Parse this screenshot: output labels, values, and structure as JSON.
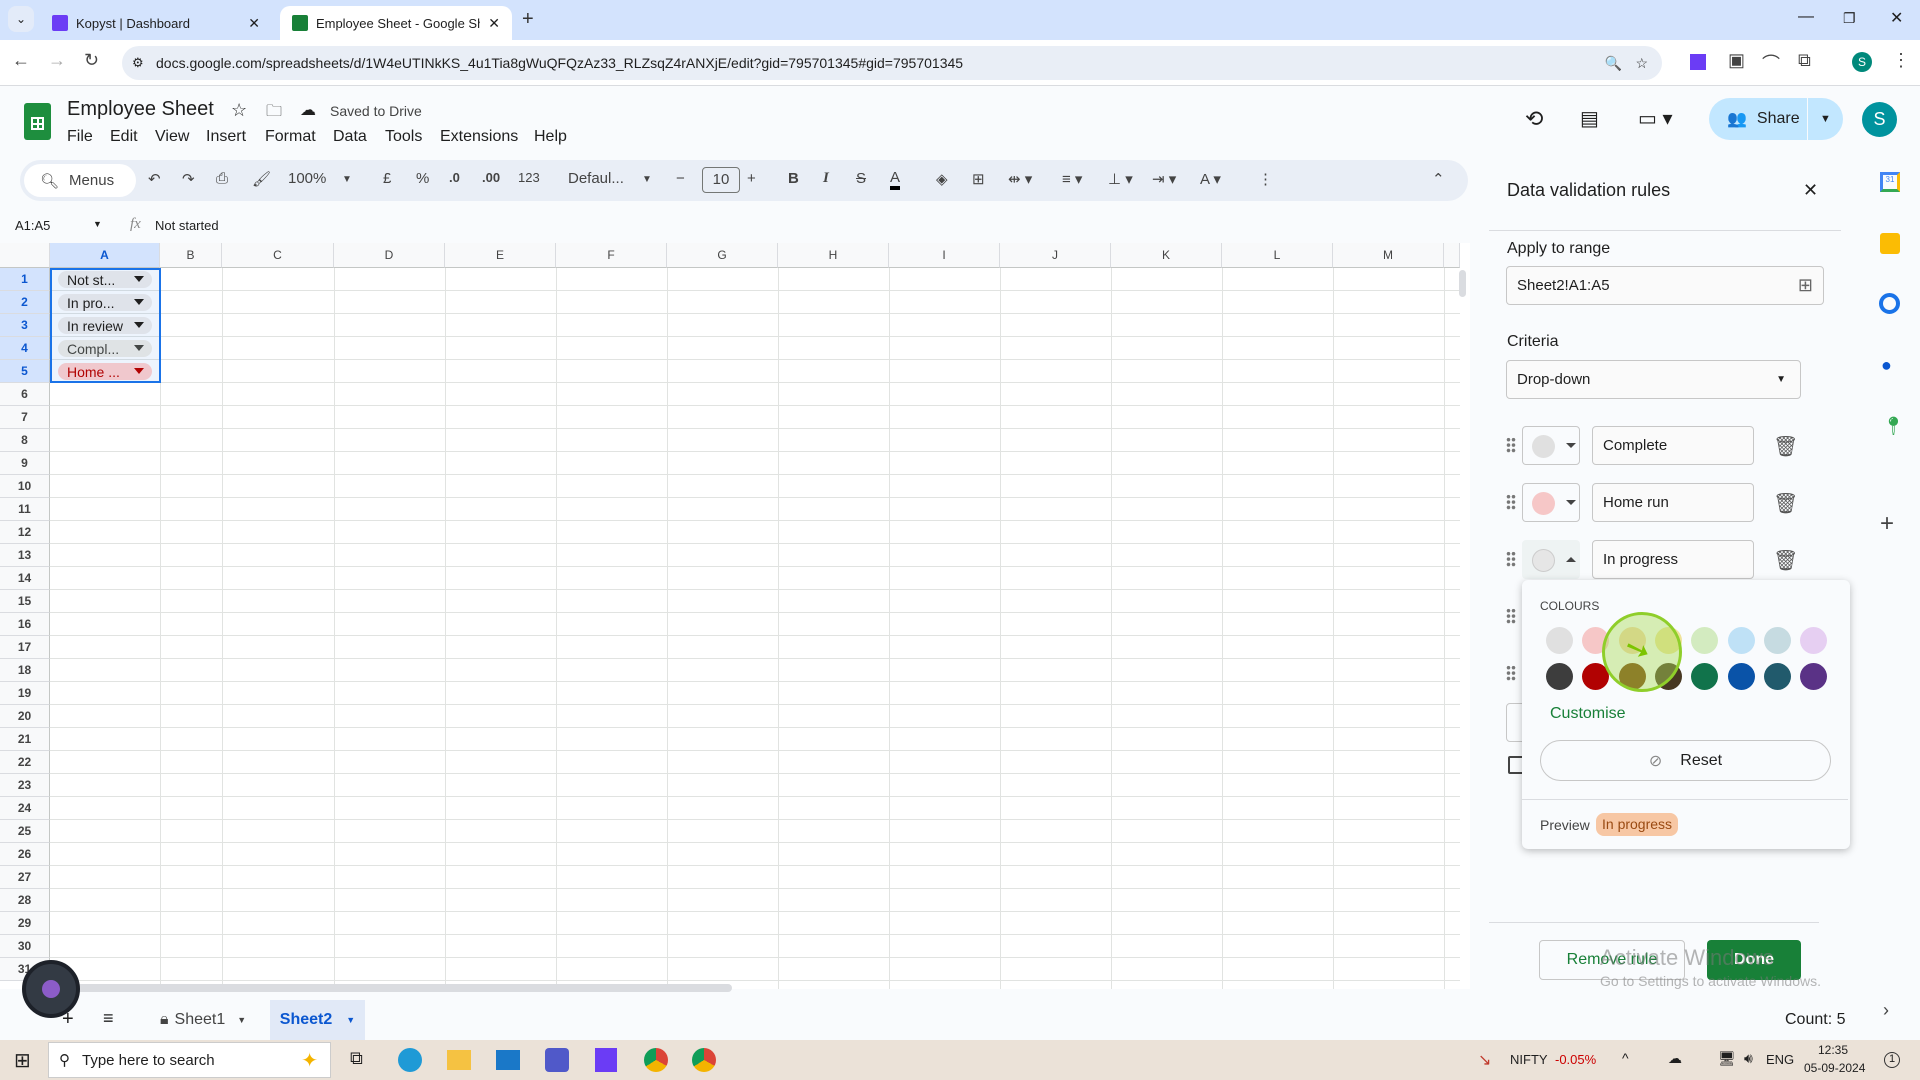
{
  "browser": {
    "tabs": [
      {
        "label": "Kopyst | Dashboard",
        "active": false
      },
      {
        "label": "Employee Sheet - Google Sheets",
        "active": true
      }
    ],
    "url": "docs.google.com/spreadsheets/d/1W4eUTINkKS_4u1Tia8gWuQFQzAz33_RLZsqZ4rANXjE/edit?gid=795701345#gid=795701345",
    "new_tab": "+",
    "profile": "S"
  },
  "doc": {
    "title": "Employee Sheet",
    "save_status": "Saved to Drive",
    "menus": [
      "File",
      "Edit",
      "View",
      "Insert",
      "Format",
      "Data",
      "Tools",
      "Extensions",
      "Help"
    ],
    "share": "Share",
    "avatar": "S"
  },
  "toolbar": {
    "search": "Menus",
    "zoom": "100%",
    "currency": "£",
    "percent": "%",
    "dec_dec": ".0",
    "inc_dec": ".00",
    "format_num": "123",
    "font": "Defaul...",
    "font_size": "10",
    "minus": "−",
    "plus": "+",
    "bold": "B",
    "italic": "I"
  },
  "formula_bar": {
    "name_box": "A1:A5",
    "fx": "fx",
    "value": "Not started"
  },
  "grid": {
    "columns": [
      "A",
      "B",
      "C",
      "D",
      "E",
      "F",
      "G",
      "H",
      "I",
      "J",
      "K",
      "L",
      "M"
    ],
    "rows": [
      "1",
      "2",
      "3",
      "4",
      "5",
      "6",
      "7",
      "8",
      "9",
      "10",
      "11",
      "12",
      "13",
      "14",
      "15",
      "16",
      "17",
      "18",
      "19",
      "20",
      "21",
      "22",
      "23",
      "24",
      "25",
      "26",
      "27",
      "28",
      "29",
      "30",
      "31"
    ],
    "cells": [
      {
        "text": "Not st...",
        "bg": "#dfe3ea",
        "fg": "#1f1f1f"
      },
      {
        "text": "In pro...",
        "bg": "#dfe3ea",
        "fg": "#1f1f1f"
      },
      {
        "text": "In review",
        "bg": "#dfe3ea",
        "fg": "#1f1f1f"
      },
      {
        "text": "Compl...",
        "bg": "#dfe3e5",
        "fg": "#444746"
      },
      {
        "text": "Home ...",
        "bg": "#f0c8cd",
        "fg": "#b10202"
      }
    ]
  },
  "sheets": {
    "tabs": [
      "Sheet1",
      "Sheet2"
    ],
    "active": "Sheet2",
    "count": "Count: 5"
  },
  "panel": {
    "title": "Data validation rules",
    "apply_label": "Apply to range",
    "range": "Sheet2!A1:A5",
    "criteria_label": "Criteria",
    "criteria": "Drop-down",
    "items": [
      {
        "value": "Complete",
        "color": "#e0e0e0"
      },
      {
        "value": "Home run",
        "color": "#f6c7c7"
      },
      {
        "value": "In progress",
        "color": "#e6e6e6"
      }
    ],
    "remove": "Remove rule",
    "done": "Done"
  },
  "colour_picker": {
    "heading": "COLOURS",
    "light": [
      "#e0e0e0",
      "#f6c7c7",
      "#f4d6a8",
      "#efe39a",
      "#d3ebc0",
      "#bfe1f6",
      "#c6dbe1",
      "#e6cff2"
    ],
    "dark": [
      "#3d3d3d",
      "#b10202",
      "#753800",
      "#473822",
      "#11734b",
      "#0a53a8",
      "#215a6c",
      "#5a3286"
    ],
    "customise": "Customise",
    "reset": "Reset",
    "preview_label": "Preview",
    "preview_value": "In progress",
    "preview_bg": "#f7c7a4",
    "preview_fg": "#9a4a12"
  },
  "watermark": {
    "line1": "Activate Windows",
    "line2": "Go to Settings to activate Windows."
  },
  "taskbar": {
    "search": "Type here to search",
    "ticker": "NIFTY",
    "ticker_change": "-0.05%",
    "lang": "ENG",
    "time": "12:35",
    "date": "05-09-2024",
    "notifications": "1"
  }
}
